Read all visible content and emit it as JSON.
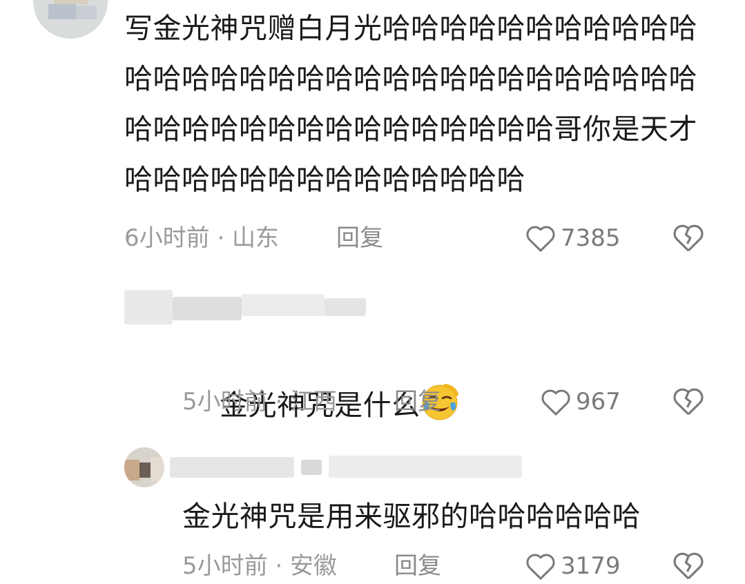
{
  "comments": [
    {
      "text": "写金光神咒赠白月光哈哈哈哈哈哈哈哈哈哈哈哈哈哈哈哈哈哈哈哈哈哈哈哈哈哈哈哈哈哈哈哈哈哈哈哈哈哈哈哈哈哈哈哈哈哈哥你是天才哈哈哈哈哈哈哈哈哈哈哈哈哈哈",
      "time": "6小时前 · 山东",
      "reply": "回复",
      "likes": "7385"
    },
    {
      "text": "金光神咒是什么",
      "emoji": "laughing-crying-emoji",
      "time": "5小时前 · 江西",
      "reply": "回复",
      "likes": "967"
    },
    {
      "text": "金光神咒是用来驱邪的哈哈哈哈哈哈",
      "time": "5小时前 · 安徽",
      "reply": "回复",
      "likes": "3179"
    }
  ],
  "icons": {
    "like": "heart-outline-icon",
    "dislike": "broken-heart-icon"
  },
  "colors": {
    "text": "#1a1a1a",
    "meta": "#9a9a9a",
    "emoji_yellow": "#f7c531",
    "emoji_tear": "#4aa3df"
  }
}
